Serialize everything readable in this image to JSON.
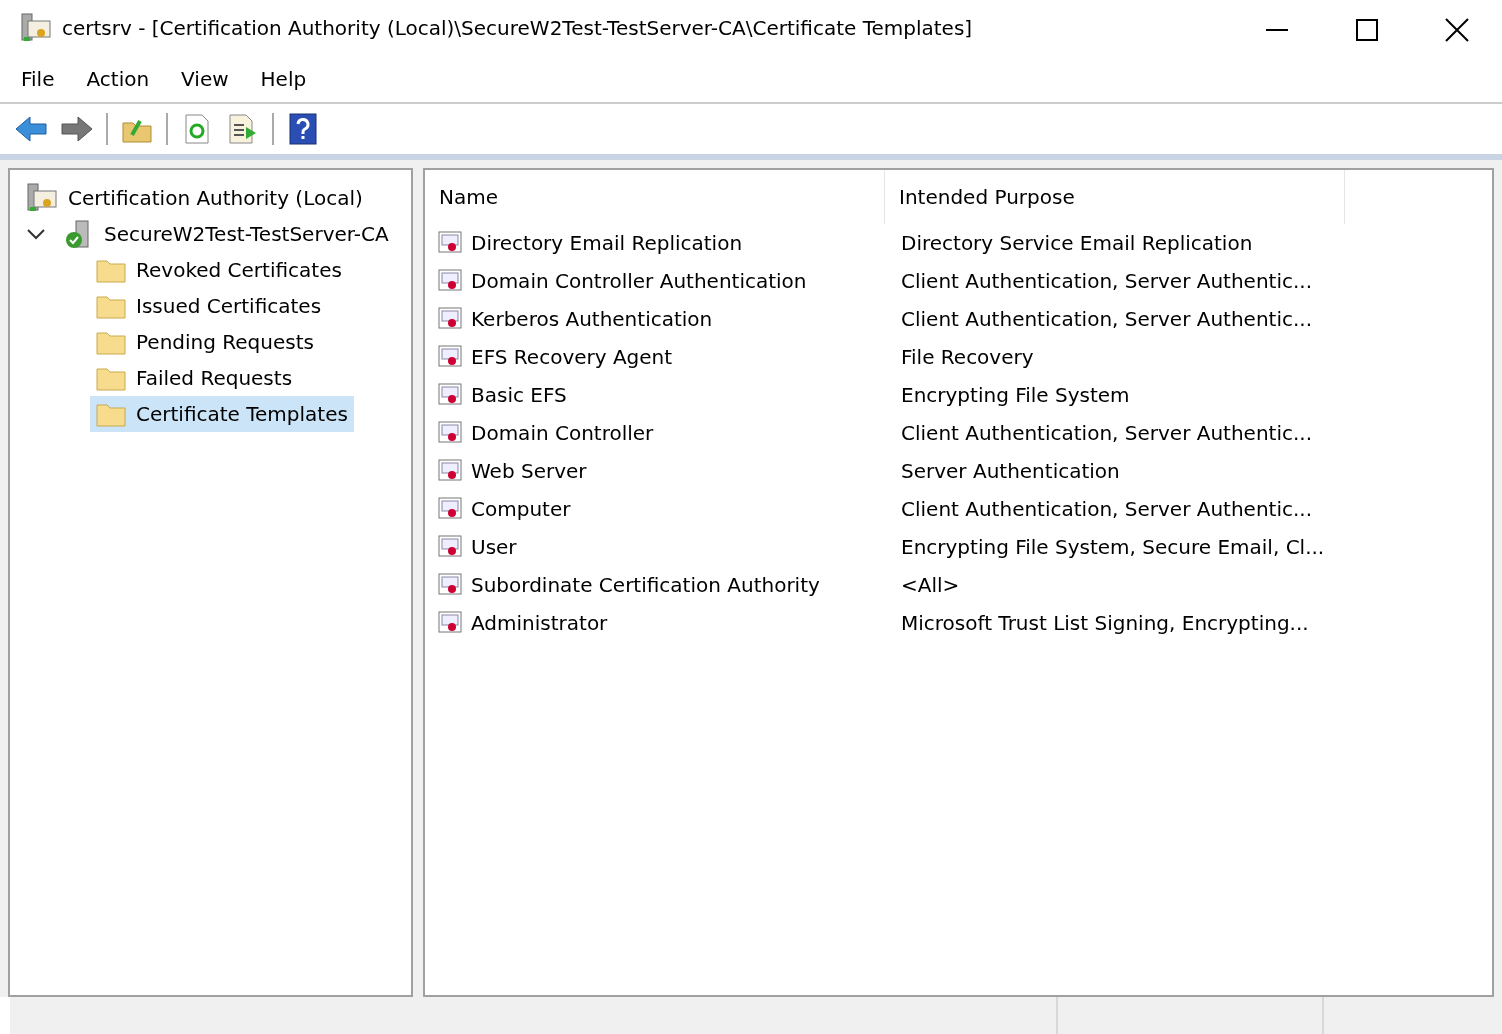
{
  "window": {
    "title": "certsrv - [Certification Authority (Local)\\SecureW2Test-TestServer-CA\\Certificate Templates]"
  },
  "menu": [
    "File",
    "Action",
    "View",
    "Help"
  ],
  "tree": [
    {
      "label": "Certification Authority (Local)",
      "kind": "root",
      "selected": false,
      "children": [
        {
          "label": "SecureW2Test-TestServer-CA",
          "kind": "server",
          "selected": false,
          "expanded": true,
          "children": [
            {
              "label": "Revoked Certificates",
              "kind": "folder",
              "selected": false
            },
            {
              "label": "Issued Certificates",
              "kind": "folder",
              "selected": false
            },
            {
              "label": "Pending Requests",
              "kind": "folder",
              "selected": false
            },
            {
              "label": "Failed Requests",
              "kind": "folder",
              "selected": false
            },
            {
              "label": "Certificate Templates",
              "kind": "folder",
              "selected": true
            }
          ]
        }
      ]
    }
  ],
  "table": {
    "columns": [
      "Name",
      "Intended Purpose"
    ],
    "rows": [
      [
        "Directory Email Replication",
        "Directory Service Email Replication"
      ],
      [
        "Domain Controller Authentication",
        "Client Authentication, Server Authentic..."
      ],
      [
        "Kerberos Authentication",
        "Client Authentication, Server Authentic..."
      ],
      [
        "EFS Recovery Agent",
        "File Recovery"
      ],
      [
        "Basic EFS",
        "Encrypting File System"
      ],
      [
        "Domain Controller",
        "Client Authentication, Server Authentic..."
      ],
      [
        "Web Server",
        "Server Authentication"
      ],
      [
        "Computer",
        "Client Authentication, Server Authentic..."
      ],
      [
        "User",
        "Encrypting File System, Secure Email, Cl..."
      ],
      [
        "Subordinate Certification Authority",
        "<All>"
      ],
      [
        "Administrator",
        "Microsoft Trust List Signing, Encrypting..."
      ]
    ]
  }
}
